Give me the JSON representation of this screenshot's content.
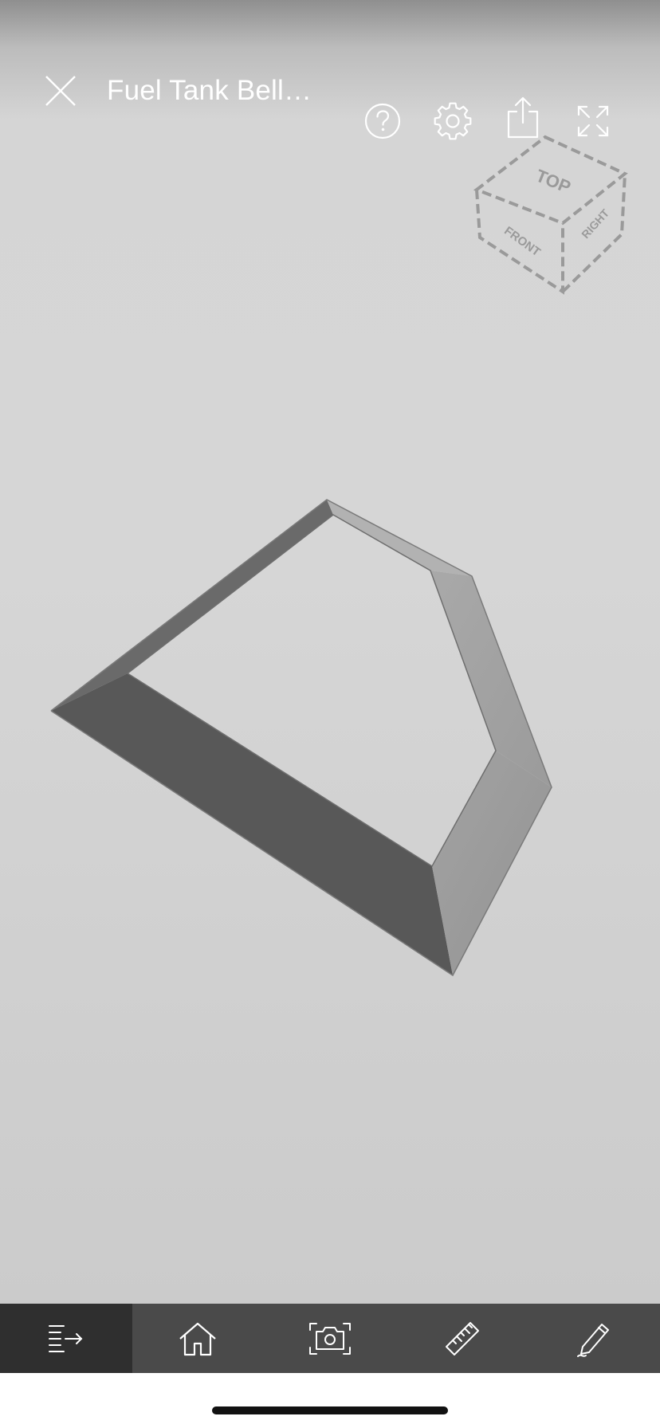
{
  "header": {
    "title": "Fuel Tank Bell…",
    "close_icon": "close-icon",
    "help_icon": "help-icon",
    "settings_icon": "gear-icon",
    "share_icon": "share-icon",
    "fullscreen_icon": "fullscreen-icon"
  },
  "viewcube": {
    "faces": {
      "top": "TOP",
      "front": "FRONT",
      "right": "RIGHT"
    }
  },
  "toolbar": {
    "items": [
      {
        "icon": "model-browser-icon",
        "active": true
      },
      {
        "icon": "home-icon",
        "active": false
      },
      {
        "icon": "camera-icon",
        "active": false
      },
      {
        "icon": "ruler-icon",
        "active": false
      },
      {
        "icon": "pencil-icon",
        "active": false
      }
    ]
  },
  "colors": {
    "toolbar_bg": "#4a4a4a",
    "toolbar_active_bg": "#2f2f2f",
    "icon": "#ffffff"
  }
}
